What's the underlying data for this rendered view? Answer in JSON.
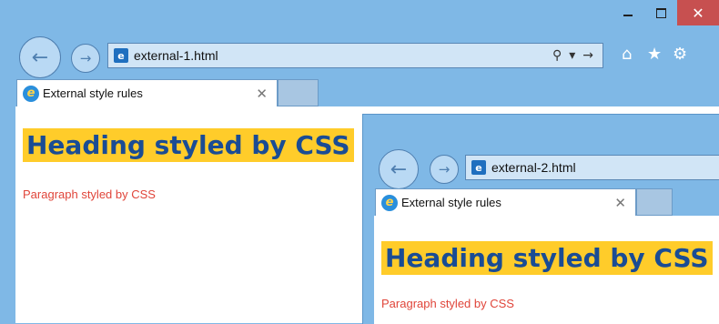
{
  "window1": {
    "url": "external-1.html",
    "tab_title": "External style rules",
    "heading": "Heading styled by CSS",
    "paragraph": "Paragraph styled by CSS",
    "caption": {
      "minimize": "",
      "maximize": "",
      "close": "✕"
    }
  },
  "window2": {
    "url": "external-2.html",
    "tab_title": "External style rules",
    "heading": "Heading styled by CSS",
    "paragraph": "Paragraph styled by CSS"
  },
  "icons": {
    "back": "back-arrow-icon",
    "forward": "forward-arrow-icon",
    "search": "search-icon",
    "dropdown": "chevron-down-icon",
    "go": "go-arrow-icon",
    "home": "home-icon",
    "favorites": "star-icon",
    "settings": "gear-icon",
    "tab_close": "close-icon",
    "page": "page-icon",
    "ie": "ie-icon"
  },
  "colors": {
    "frame": "#7fb8e6",
    "heading_bg": "#ffcc2a",
    "heading_text": "#1a4c94",
    "paragraph_text": "#e0453a",
    "close_button": "#c75050"
  }
}
